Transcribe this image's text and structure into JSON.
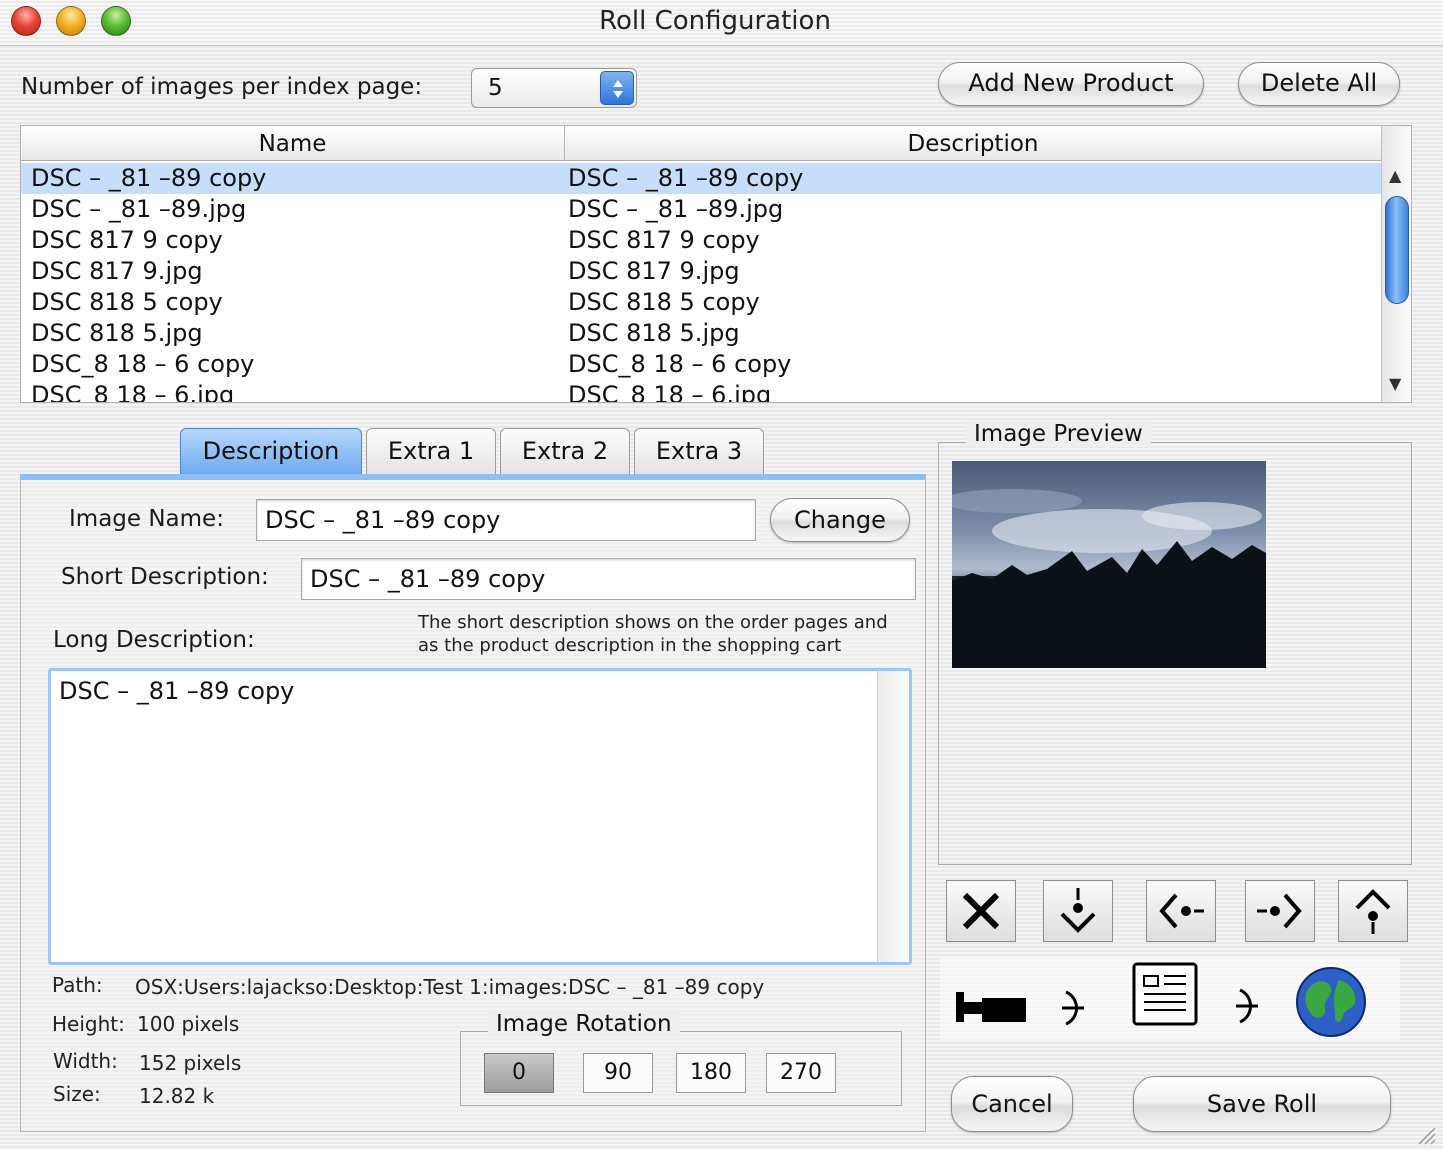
{
  "window": {
    "title": "Roll Configuration"
  },
  "toolbar": {
    "images_per_page_label": "Number of images per index page:",
    "images_per_page_value": "5",
    "add_new_product": "Add New Product",
    "delete_all": "Delete All"
  },
  "table": {
    "columns": [
      "Name",
      "Description"
    ],
    "rows": [
      {
        "name": "DSC – _81 –89 copy",
        "description": "DSC – _81 –89 copy",
        "selected": true
      },
      {
        "name": "DSC – _81 –89.jpg",
        "description": "DSC – _81 –89.jpg"
      },
      {
        "name": "DSC 817 9 copy",
        "description": "DSC 817 9 copy"
      },
      {
        "name": "DSC 817 9.jpg",
        "description": "DSC 817 9.jpg"
      },
      {
        "name": "DSC 818 5 copy",
        "description": "DSC 818 5 copy"
      },
      {
        "name": "DSC 818 5.jpg",
        "description": "DSC 818 5.jpg"
      },
      {
        "name": "DSC_8 18 – 6 copy",
        "description": "DSC_8 18 – 6 copy"
      },
      {
        "name": "DSC_8 18 – 6.jpg",
        "description": "DSC_8 18 – 6.jpg"
      }
    ]
  },
  "tabs": [
    {
      "label": "Description",
      "active": true
    },
    {
      "label": "Extra 1"
    },
    {
      "label": "Extra 2"
    },
    {
      "label": "Extra 3"
    }
  ],
  "form": {
    "image_name_label": "Image Name:",
    "image_name_value": "DSC – _81 –89 copy",
    "change_button": "Change",
    "short_desc_label": "Short Description:",
    "short_desc_value": "DSC – _81 –89 copy",
    "long_desc_label": "Long Description:",
    "hint_line1": "The short description shows on the order pages and",
    "hint_line2": "as the product description in the shopping cart",
    "long_desc_value": "DSC – _81 –89 copy"
  },
  "info": {
    "path_label": "Path:",
    "path_value": "OSX:Users:lajackso:Desktop:Test 1:images:DSC – _81 –89 copy",
    "height_label": "Height:",
    "height_value": "100 pixels",
    "width_label": "Width:",
    "width_value": "152 pixels",
    "size_label": "Size:",
    "size_value": "12.82 k"
  },
  "rotation": {
    "title": "Image Rotation",
    "options": [
      "0",
      "90",
      "180",
      "270"
    ],
    "selected": "0"
  },
  "preview": {
    "title": "Image Preview"
  },
  "nav_icons": [
    "delete-x-icon",
    "move-down-icon",
    "move-left-icon",
    "move-right-icon",
    "move-up-icon"
  ],
  "workflow_icons": [
    "camera-icon",
    "arrow-icon",
    "document-icon",
    "arrow-icon",
    "globe-icon"
  ],
  "footer": {
    "cancel": "Cancel",
    "save": "Save Roll"
  },
  "colors": {
    "selection": "#c7defa",
    "accent_blue": "#6ba9ef",
    "scroll_thumb": "#2e6fd0"
  }
}
